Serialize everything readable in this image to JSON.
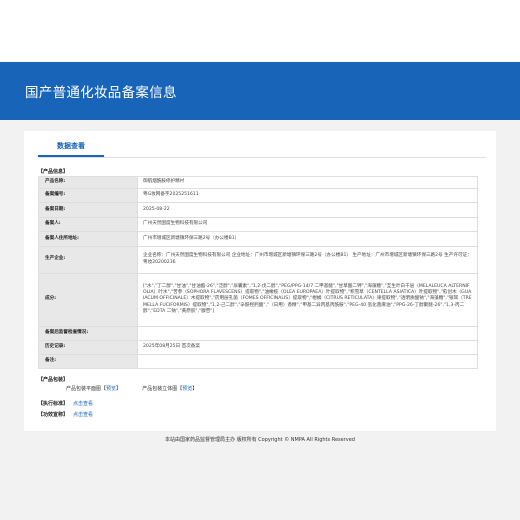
{
  "header": {
    "title": "国产普通化妆品备案信息"
  },
  "tabs": [
    {
      "label": "数据查看"
    }
  ],
  "product_info": {
    "section_title": "【产品信息】",
    "rows": [
      {
        "label": "产品名称:",
        "value": "御肌烟酰胺修护精衬"
      },
      {
        "label": "备案编号:",
        "value": "粤G妆网备字2025251611"
      },
      {
        "label": "备案日期:",
        "value": "2025-08-22"
      },
      {
        "label": "备案人:",
        "value": "广州天然国度生物科技有限公司"
      },
      {
        "label": "备案人住所地址:",
        "value": "广州市增城区新塘镇环保三路2号（办公楼B1）"
      },
      {
        "label": "生产企业:",
        "value": "企业名称：广州天然国度生物科技有限公司 企业地址：广州市增城区新塘镇环保三路2号（办公楼B1） 生产地址：广州市增城区新塘镇环保三路2号 生产许可证：粤妆20200236"
      },
      {
        "label": "成分:",
        "value": "[\"水\",\"丁二醇\",\"甘油\",\"甘油酯-26\",\"泛醇\",\"尿囊素\",\"1,2-戊二醇\",\"PEG/PPG-14/7 二甲基醚\",\"甘草酸二钾\",\"海藻糖\",\"互生叶白千层（MELALEUCA ALTERNIFOLIA）叶水\",\"苦参（SOPHORA FLAVESCENS）提取物\",\"油橄榄（OLEA EUROPAEA）叶提取物\",\"积雪草（CENTELLA ASIATICA）叶提取物\",\"愈创木（GUAIACUM OFFICINALE）木提取物\",\"药用层孔菌（FOMES OFFICINALIS）提取物\",\"柑橘（CITRUS RETICULATA）果提取物\",\"透明质酸钠\",\"海藻糖\",\"银耳（TREMELLA FUCIFORMIS）提取物\",\"1,2-己二醇\",\"辛酰羟肟酸\",\"（日用）香精\",\"甲基二异丙基丙酰胺\",\"PEG-40 氢化蓖麻油\",\"PPG-26-丁醇聚醚-26\",\"1,3-丙二醇\",\"EDTA 二钠\",\"黄原胶\",\"腺苷\"]"
      },
      {
        "label": "备案后监督检查情况:",
        "value": ""
      },
      {
        "label": "历史记录:",
        "value": "2025年08月25日 首次备案"
      },
      {
        "label": "备注:",
        "value": ""
      }
    ]
  },
  "packaging": {
    "section_title": "【产品包装】",
    "items": [
      {
        "label": "产品包装平面图",
        "link": "预览"
      },
      {
        "label": "产品包装立体图",
        "link": "预览"
      }
    ]
  },
  "standard": {
    "section_title": "【执行标准】",
    "link": "点击查看"
  },
  "efficacy": {
    "section_title": "【功效宣称】",
    "link": "点击查看"
  },
  "footer": {
    "text": "本站由国家药品监督管理局主办 版权所有 Copyright © NMPA All Rights Reserved"
  },
  "colors": {
    "brand": "#1764b8",
    "label_bg": "#e8e8e8",
    "page_bg": "#f2f2f2"
  }
}
